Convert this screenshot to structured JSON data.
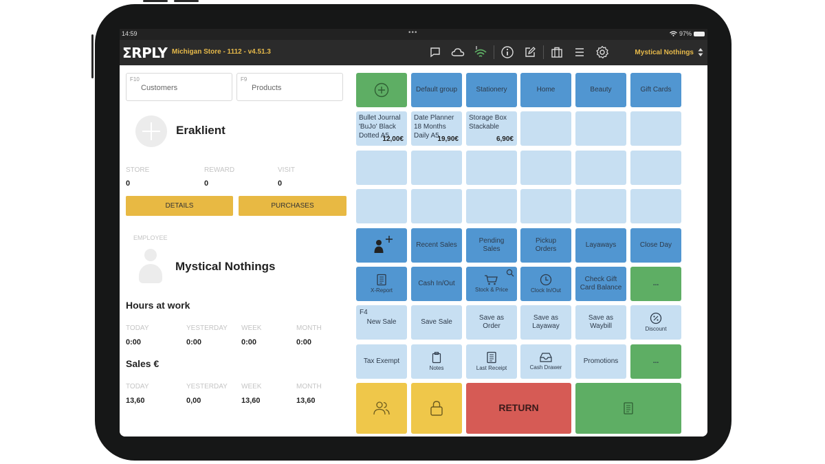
{
  "status_bar": {
    "time": "14:59",
    "battery": "97%"
  },
  "app_bar": {
    "logo": "ΣRPLY",
    "store_info": "Michigan Store - 1112 - v4.51.3",
    "icons": [
      "chat-icon",
      "cloud-icon",
      "wifi-signal-icon",
      "info-icon",
      "edit-icon",
      "briefcase-icon",
      "menu-icon",
      "gear-icon"
    ],
    "current_user": "Mystical Nothings"
  },
  "left_panel": {
    "customer_search": {
      "fkey": "F10",
      "placeholder": "Customers"
    },
    "product_search": {
      "fkey": "F9",
      "placeholder": "Products"
    },
    "customer_name": "Eraklient",
    "customer_stats": [
      {
        "label": "STORE",
        "value": "0"
      },
      {
        "label": "REWARD",
        "value": "0"
      },
      {
        "label": "VISIT",
        "value": "0"
      }
    ],
    "details_button": "DETAILS",
    "purchases_button": "PURCHASES",
    "employee_label": "EMPLOYEE",
    "employee_name": "Mystical Nothings",
    "hours_title": "Hours at work",
    "hours": [
      {
        "label": "TODAY",
        "value": "0:00"
      },
      {
        "label": "YESTERDAY",
        "value": "0:00"
      },
      {
        "label": "WEEK",
        "value": "0:00"
      },
      {
        "label": "MONTH",
        "value": "0:00"
      }
    ],
    "sales_title": "Sales €",
    "sales": [
      {
        "label": "TODAY",
        "value": "13,60"
      },
      {
        "label": "YESTERDAY",
        "value": "0,00"
      },
      {
        "label": "WEEK",
        "value": "13,60"
      },
      {
        "label": "MONTH",
        "value": "13,60"
      }
    ]
  },
  "grid": {
    "product_groups": [
      "Default group",
      "Stationery",
      "Home",
      "Beauty",
      "Gift Cards"
    ],
    "products": [
      {
        "name": "Bullet Journal 'BuJo' Black Dotted A5",
        "price": "12,00€"
      },
      {
        "name": "Date Planner 18 Months Daily A5",
        "price": "19,90€"
      },
      {
        "name": "Storage Box Stackable",
        "price": "6,90€"
      }
    ],
    "functions_row1": [
      "Recent Sales",
      "Pending Sales",
      "Pickup Orders",
      "Layaways",
      "Close Day"
    ],
    "functions_row2": {
      "x_report": "X-Report",
      "cash_in_out": "Cash In/Out",
      "stock_price": "Stock & Price",
      "clock_in_out": "Clock In/Out",
      "check_gift_card": "Check Gift Card Balance",
      "more": "..."
    },
    "functions_row3": {
      "new_sale_fkey": "F4",
      "new_sale": "New Sale",
      "save_sale": "Save Sale",
      "save_order": "Save as Order",
      "save_layaway": "Save as Layaway",
      "save_waybill": "Save as Waybill",
      "discount": "Discount"
    },
    "functions_row4": {
      "tax_exempt": "Tax Exempt",
      "notes": "Notes",
      "last_receipt": "Last Receipt",
      "cash_drawer": "Cash Drawer",
      "promotions": "Promotions",
      "more": "..."
    },
    "bottom": {
      "return": "RETURN"
    }
  },
  "colors": {
    "accent_yellow": "#e8b943",
    "tile_blue": "#5196d1",
    "tile_light_blue": "#c7dff2",
    "tile_green": "#5eae64",
    "tile_red": "#d65b55",
    "header_text": "#e6b94a"
  }
}
